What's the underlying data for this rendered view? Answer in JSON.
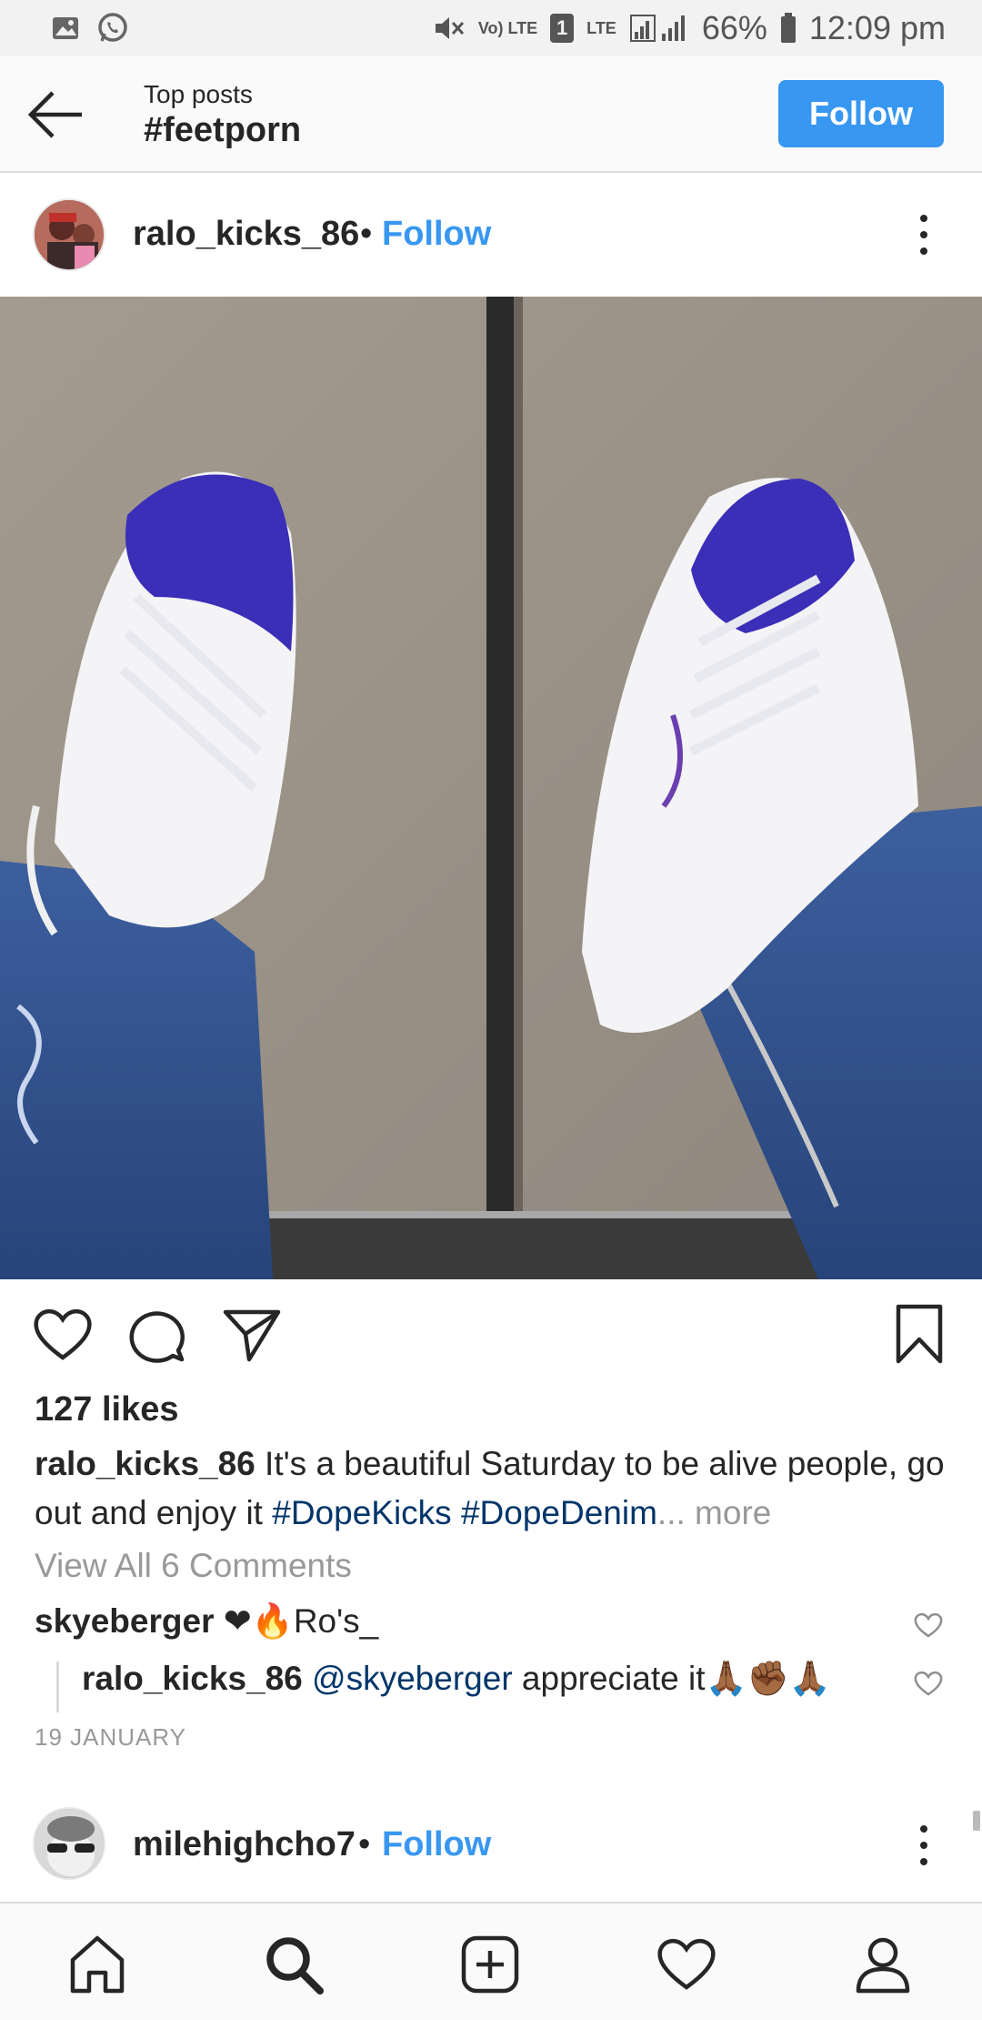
{
  "status_bar": {
    "battery": "66%",
    "time": "12:09 pm",
    "volte": "Vo) LTE",
    "sim": "1",
    "network": "LTE"
  },
  "header": {
    "subtitle": "Top posts",
    "title": "#feetporn",
    "follow_label": "Follow",
    "accent_color": "#3897f0"
  },
  "post": {
    "username": "ralo_kicks_86",
    "separator": "•",
    "follow_label": "Follow",
    "likes": "127 likes",
    "caption_user": "ralo_kicks_86",
    "caption_text": "It's a beautiful Saturday to be alive people, go out and enjoy it",
    "caption_tags": "#DopeKicks #DopeDenim",
    "caption_more": "... more",
    "view_all": "View All 6 Comments",
    "comments": [
      {
        "user": "skyeberger",
        "text": "❤🔥Ro's_"
      },
      {
        "user": "ralo_kicks_86",
        "mention": "@skyeberger",
        "text": "appreciate it🙏🏾✊🏾🙏🏾"
      }
    ],
    "date": "19 JANUARY"
  },
  "next_post": {
    "username": "milehighcho7",
    "separator": "•",
    "follow_label": "Follow"
  },
  "icons": {
    "back": "arrow-left-icon",
    "more": "vertical-dots-icon",
    "like": "heart-icon",
    "comment": "comment-bubble-icon",
    "share": "paper-plane-icon",
    "save": "bookmark-icon",
    "nav": [
      "home-icon",
      "search-icon",
      "add-post-icon",
      "activity-heart-icon",
      "profile-icon"
    ]
  }
}
